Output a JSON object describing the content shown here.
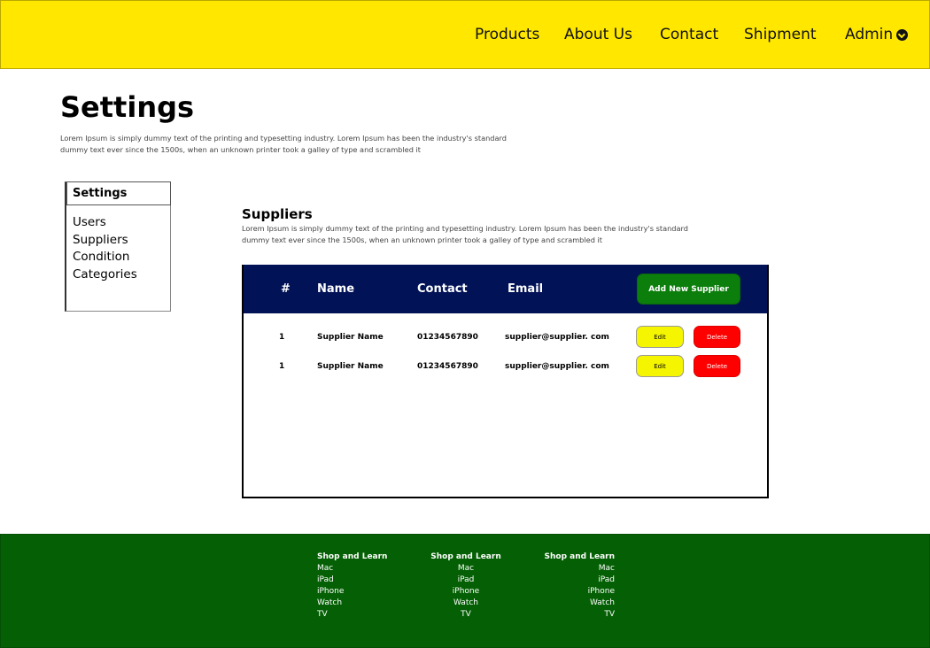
{
  "header": {
    "nav": [
      "Products",
      "About Us",
      "Contact",
      "Shipment"
    ],
    "admin_label": "Admin"
  },
  "page": {
    "title": "Settings",
    "description": "Lorem Ipsum is simply dummy text of the printing and typesetting industry. Lorem Ipsum has been the industry's standard dummy text ever since the 1500s, when an unknown printer took a galley of type and scrambled it"
  },
  "sidebar": {
    "heading": "Settings",
    "items": [
      "Users",
      "Suppliers",
      "Condition",
      "Categories"
    ]
  },
  "suppliers": {
    "title": "Suppliers",
    "description": "Lorem Ipsum is simply dummy text of the printing and typesetting industry. Lorem Ipsum has been the industry's standard dummy text ever since the 1500s, when an unknown printer took a galley of type and scrambled it",
    "columns": [
      "#",
      "Name",
      "Contact",
      "Email"
    ],
    "add_button": "Add New Supplier",
    "edit_label": "Edit",
    "delete_label": "Delete",
    "rows": [
      {
        "num": "1",
        "name": "Supplier Name",
        "contact": "01234567890",
        "email": "supplier@supplier. com"
      },
      {
        "num": "1",
        "name": "Supplier Name",
        "contact": "01234567890",
        "email": "supplier@supplier. com"
      }
    ]
  },
  "footer": {
    "columns": [
      {
        "heading": "Shop and Learn",
        "links": [
          "Mac",
          "iPad",
          "iPhone",
          "Watch",
          "TV"
        ]
      },
      {
        "heading": "Shop and Learn",
        "links": [
          "Mac",
          "iPad",
          "iPhone",
          "Watch",
          "TV"
        ]
      },
      {
        "heading": "Shop and Learn",
        "links": [
          "Mac",
          "iPad",
          "iPhone",
          "Watch",
          "TV"
        ]
      }
    ]
  },
  "colors": {
    "header_bg": "#ffe700",
    "table_header_bg": "#021257",
    "add_button_bg": "#0c7e0c",
    "edit_button_bg": "#f5f500",
    "delete_button_bg": "#ff0000",
    "footer_bg": "#056005"
  }
}
